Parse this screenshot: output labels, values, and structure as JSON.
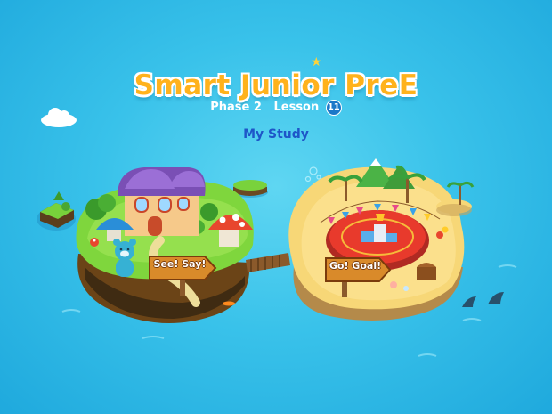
{
  "app": {
    "title": "Smart Junior PreE",
    "phase_label": "Phase 2",
    "lesson_label": "Lesson",
    "lesson_number": "11",
    "section_title": "My Study"
  },
  "islands": {
    "left_sign": "See! Say!",
    "right_sign": "Go! Goal!"
  },
  "colors": {
    "sea": "#39c2ea",
    "title": "#ffb21c",
    "section_title": "#1e56c8",
    "grass": "#7ed33b",
    "sand": "#f7d777",
    "arena": "#e83a2c"
  }
}
